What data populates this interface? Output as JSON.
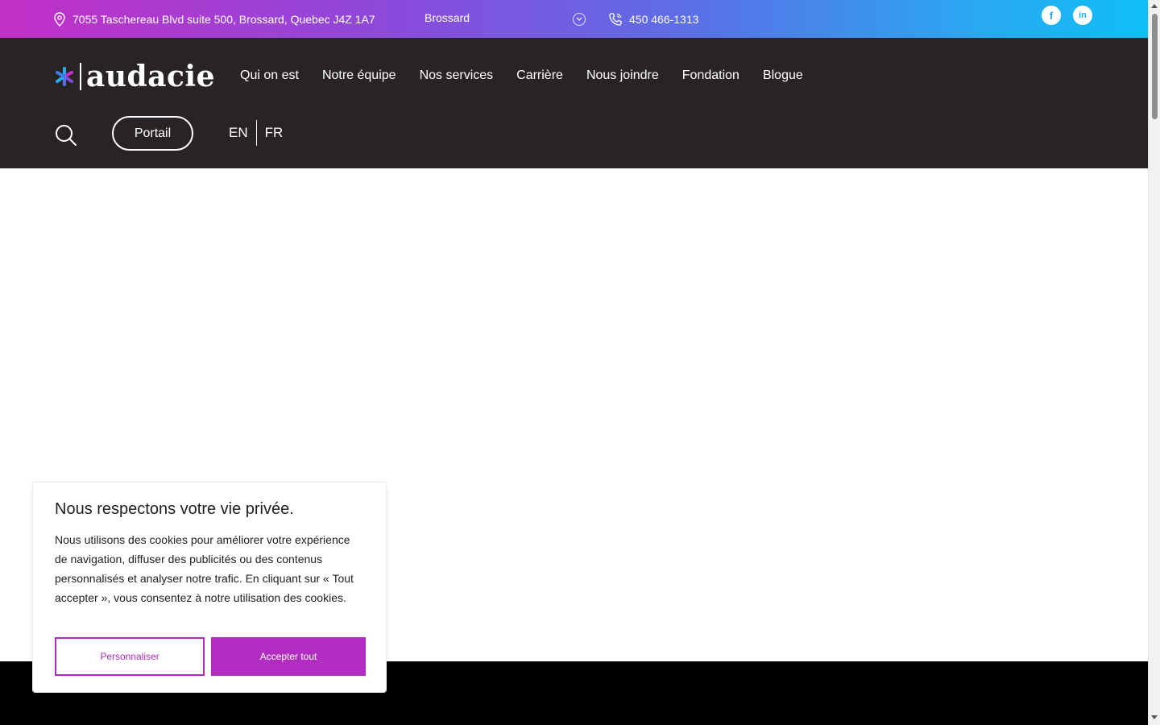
{
  "topbar": {
    "address": "7055 Taschereau Blvd suite 500, Brossard, Quebec J4Z 1A7",
    "location": "Brossard",
    "phone": "450 466-1313",
    "social": {
      "facebook": "f",
      "linkedin": "in"
    }
  },
  "header": {
    "logo_text": "audacie",
    "nav": [
      "Qui on est",
      "Notre équipe",
      "Nos services",
      "Carrière",
      "Nous joindre",
      "Fondation",
      "Blogue"
    ],
    "portal_label": "Portail",
    "lang_en": "EN",
    "lang_fr": "FR"
  },
  "cookie": {
    "title": "Nous respectons votre vie privée.",
    "body": "Nous utilisons des cookies pour améliorer votre expérience de navigation, diffuser des publicités ou des contenus personnalisés et analyser notre trafic. En cliquant sur « Tout accepter », vous consentez à notre utilisation des cookies.",
    "customize_label": "Personnaliser",
    "accept_label": "Accepter tout"
  },
  "colors": {
    "accent": "#b12cc0",
    "header_bg": "#292424",
    "gradient_start": "#c22fc6",
    "gradient_end": "#0fbff5"
  },
  "icons": {
    "address": "location-pin-icon",
    "location_caret": "chevron-down-icon",
    "phone": "phone-icon",
    "search": "search-icon"
  }
}
